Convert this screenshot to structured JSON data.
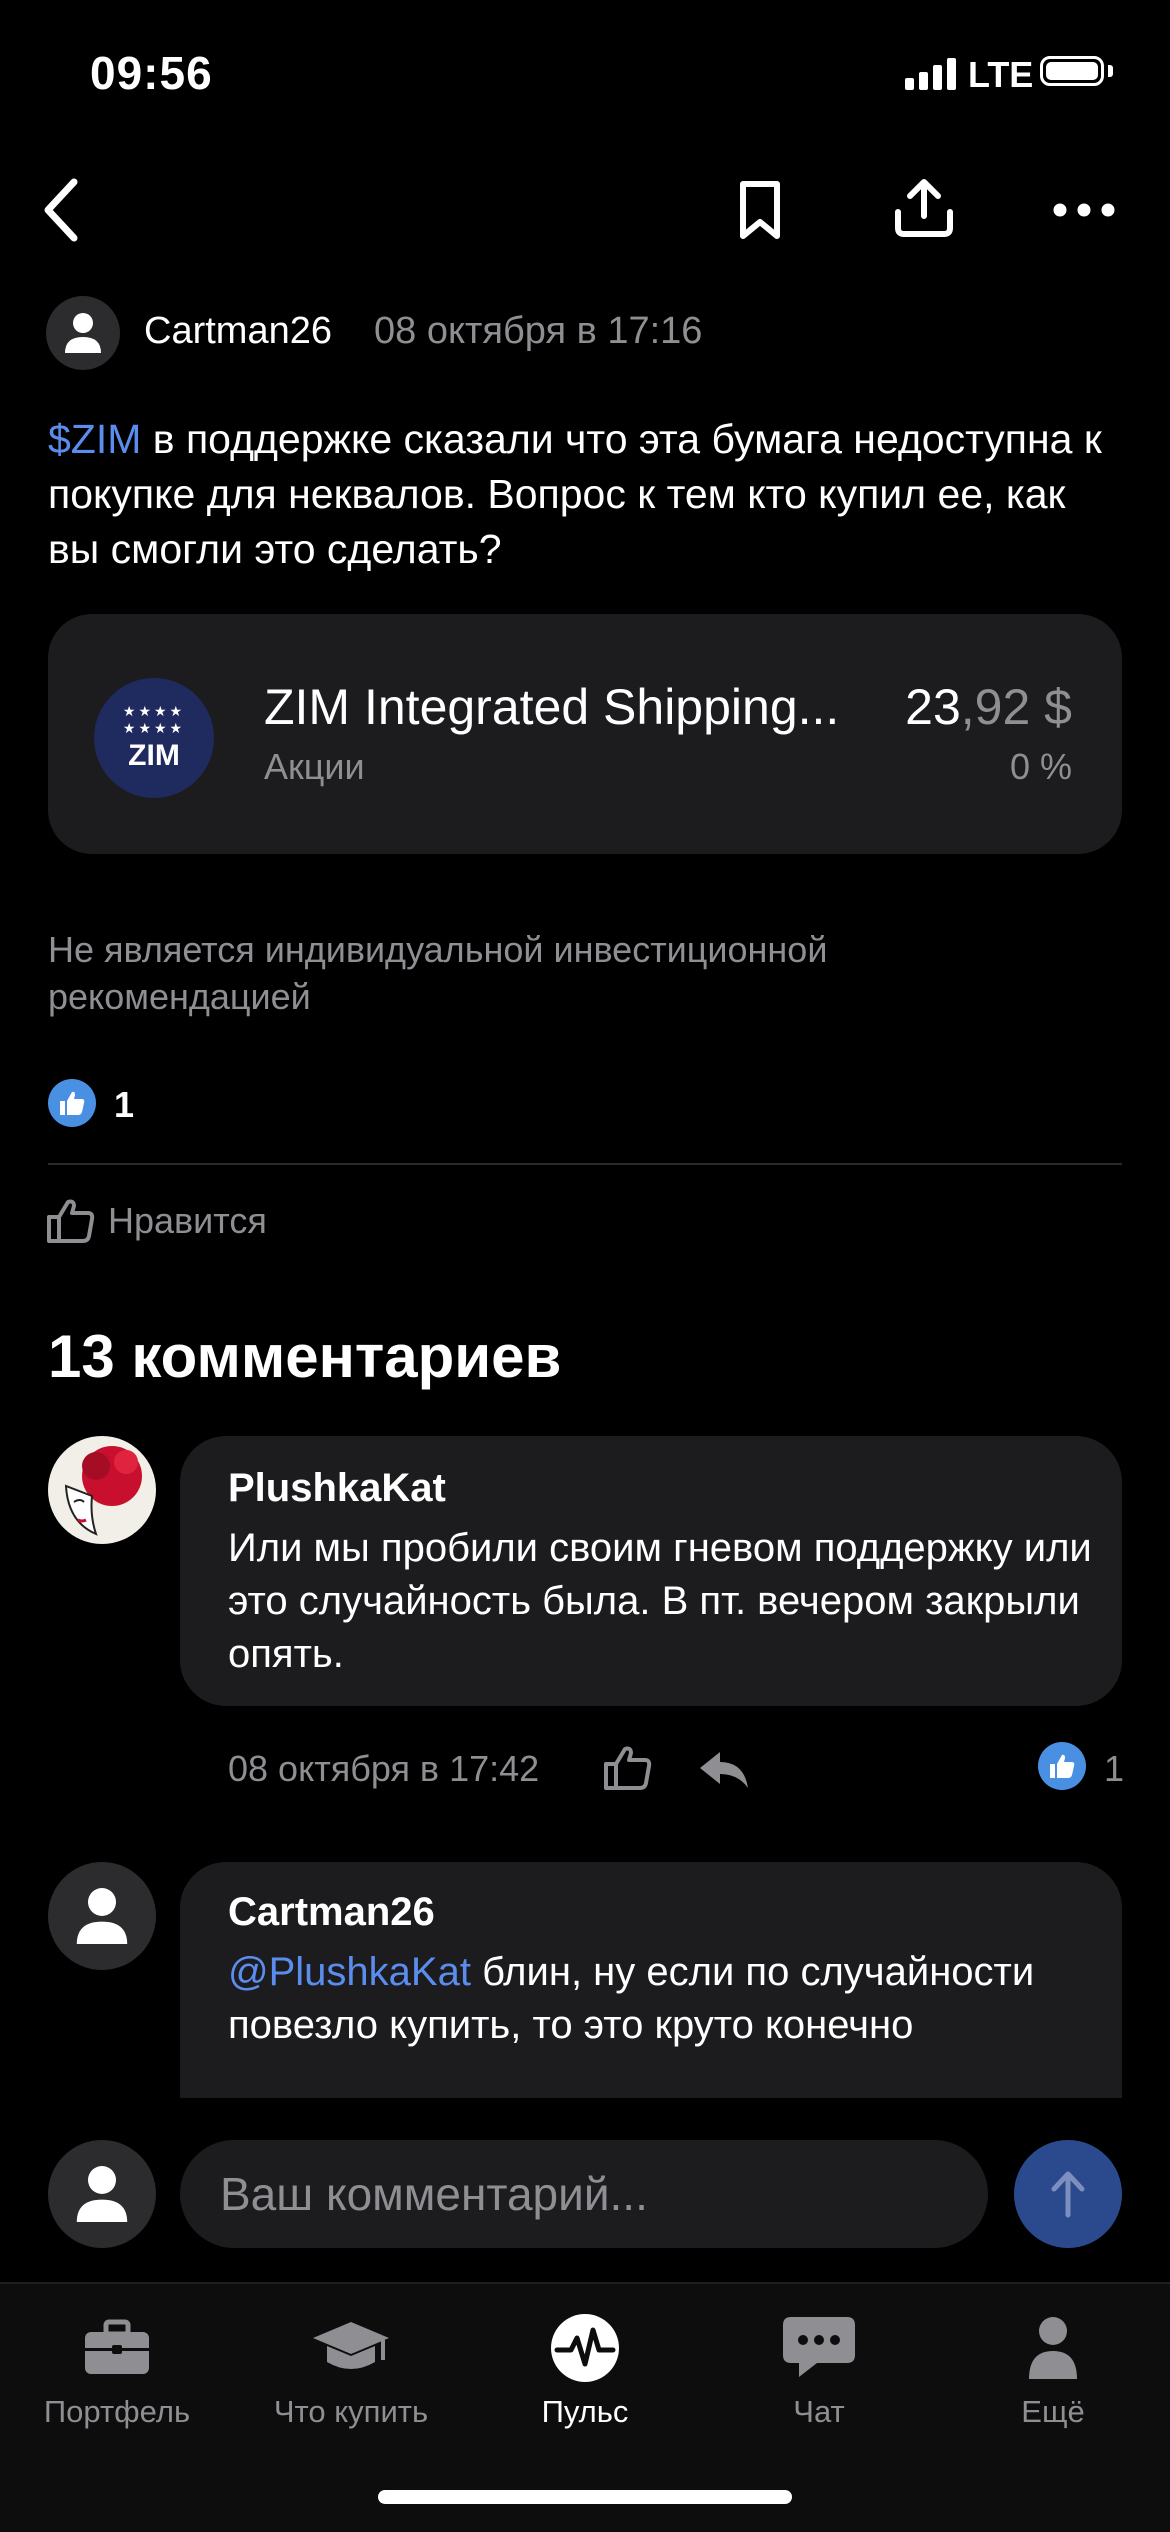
{
  "status_bar": {
    "time": "09:56",
    "network": "LTE"
  },
  "post": {
    "author": "Cartman26",
    "date": "08 октября в 17:16",
    "ticker": "$ZIM",
    "text": " в поддержке сказали что эта бумага недоступна к покупке для неквалов. Вопрос к тем кто купил ее, как вы смогли это сделать?",
    "instrument": {
      "logo_text": "ZIM",
      "name": "ZIM Integrated Shipping...",
      "type": "Акции",
      "price_int": "23",
      "price_frac": ",92 $",
      "change": "0 %"
    },
    "disclaimer": "Не является индивидуальной инвестиционной рекомендацией",
    "likes_count": "1",
    "like_label": "Нравится"
  },
  "comments": {
    "title": "13 комментариев",
    "items": [
      {
        "author": "PlushkaKat",
        "text": "Или мы пробили своим гневом поддержку или это случайность была. В пт. вечером закрыли опять.",
        "date": "08 октября в 17:42",
        "likes": "1"
      },
      {
        "author": "Cartman26",
        "mention": "@PlushkaKat",
        "text": " блин, ну если по случайности повезло купить, то это круто конечно"
      }
    ]
  },
  "comment_input": {
    "placeholder": "Ваш комментарий..."
  },
  "tabbar": {
    "items": [
      {
        "label": "Портфель",
        "icon": "briefcase-icon"
      },
      {
        "label": "Что купить",
        "icon": "graduation-cap-icon"
      },
      {
        "label": "Пульс",
        "icon": "pulse-icon"
      },
      {
        "label": "Чат",
        "icon": "chat-icon"
      },
      {
        "label": "Ещё",
        "icon": "person-icon"
      }
    ],
    "active": "Пульс"
  },
  "colors": {
    "accent": "#5b8def",
    "like_badge": "#4a90e2",
    "send_button": "#2b4a8e",
    "card_bg": "#1c1c1e",
    "zim_logo_bg": "#1f2a5e"
  }
}
